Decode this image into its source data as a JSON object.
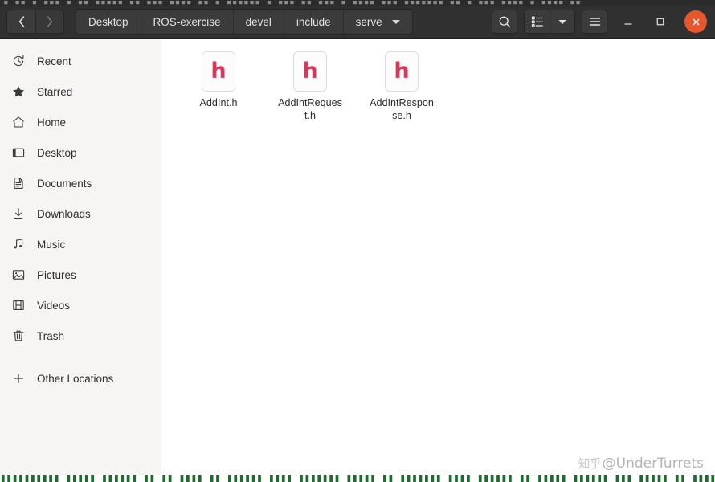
{
  "window": {
    "app": "Files",
    "close_color": "#e5572c"
  },
  "background": {
    "top_strip_text": "▪ ▪▪ ▪ ▪▪▪ ▪  ▪▪ ▪▪▪▪▪ ▪▪ ▪▪▪ ▪▪▪▪  ▪▪ ▪ ▪▪▪▪▪▪ ▪ ▪▪▪ ▪▪  ▪▪▪ ▪ ▪▪▪▪ ▪▪▪ ▪▪▪▪▪▪▪ ▪▪ ▪ ▪▪▪ ▪▪▪▪ ▪ ▪▪▪▪ ▪▪",
    "bottom_strip_text": "▌▌▌▌▌▌▌▌▌▌ ▌▌▌▌▌ ▌▌▌▌▌▌ ▌▌ ▌▌ ▌▌▌▌ ▌▌ ▌▌▌▌▌▌ ▌▌▌▌ ▌▌▌▌▌▌▌ ▌▌▌▌▌ ▌▌ ▌▌▌▌▌▌▌ ▌▌▌▌ ▌▌▌▌▌▌ ▌▌ ▌▌▌▌▌ ▌▌▌▌▌▌ ▌▌▌ ▌▌▌▌▌ ▌▌ ▌▌▌▌"
  },
  "navigation": {
    "back_label": "‹",
    "forward_label": "›"
  },
  "breadcrumb": {
    "items": [
      {
        "label": "Desktop",
        "icon": "folder-crumb"
      },
      {
        "label": "ROS-exercise",
        "icon": "folder-crumb"
      },
      {
        "label": "devel",
        "icon": "folder-crumb"
      },
      {
        "label": "include",
        "icon": "folder-crumb"
      },
      {
        "label": "serve",
        "icon": "folder-crumb-current"
      }
    ]
  },
  "toolbar": {
    "search_label": "Search",
    "view_list_label": "List view",
    "view_options_label": "View options",
    "menu_label": "Main menu",
    "minimize_label": "Minimize",
    "maximize_label": "Maximize",
    "close_label": "Close"
  },
  "sidebar": {
    "items": [
      {
        "label": "Recent",
        "icon": "clock-icon"
      },
      {
        "label": "Starred",
        "icon": "star-icon"
      },
      {
        "label": "Home",
        "icon": "home-icon"
      },
      {
        "label": "Desktop",
        "icon": "desktop-icon"
      },
      {
        "label": "Documents",
        "icon": "document-icon"
      },
      {
        "label": "Downloads",
        "icon": "download-icon"
      },
      {
        "label": "Music",
        "icon": "music-note-icon"
      },
      {
        "label": "Pictures",
        "icon": "picture-icon"
      },
      {
        "label": "Videos",
        "icon": "film-icon"
      },
      {
        "label": "Trash",
        "icon": "trash-icon"
      }
    ],
    "other_locations": {
      "label": "Other Locations",
      "icon": "plus-icon"
    }
  },
  "files": [
    {
      "name": "AddInt.h",
      "type": "header-file",
      "glyph": "h"
    },
    {
      "name": "AddIntRequest.h",
      "type": "header-file",
      "glyph": "h"
    },
    {
      "name": "AddIntResponse.h",
      "type": "header-file",
      "glyph": "h"
    }
  ],
  "watermark": {
    "cjk": "知乎",
    "handle": "@UnderTurrets"
  }
}
